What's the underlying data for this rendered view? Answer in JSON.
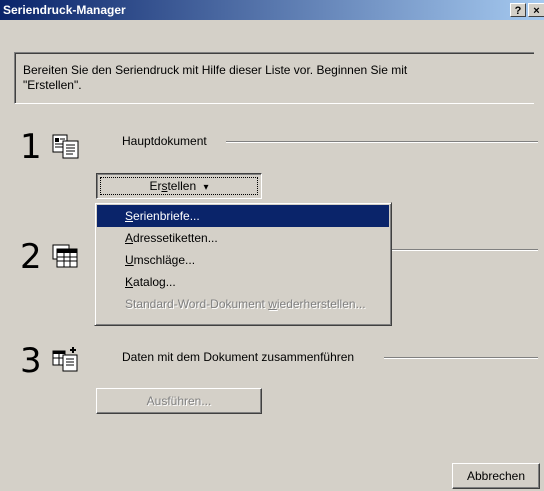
{
  "window": {
    "title": "Seriendruck-Manager",
    "help_label": "?",
    "close_label": "×"
  },
  "instructions": {
    "line1": "Bereiten Sie den Seriendruck mit Hilfe dieser Liste vor. Beginnen Sie mit",
    "line2": "\"Erstellen\"."
  },
  "steps": [
    {
      "number": "1",
      "label": "Hauptdokument",
      "icon": "main-document-icon"
    },
    {
      "number": "2",
      "label": "",
      "icon": "data-source-icon"
    },
    {
      "number": "3",
      "label": "Daten mit dem Dokument zusammenführen",
      "icon": "merge-icon"
    }
  ],
  "buttons": {
    "create_pre": "Er",
    "create_acc": "s",
    "create_post": "tellen",
    "create_arrow": "▾",
    "execute": "Ausführen...",
    "cancel": "Abbrechen"
  },
  "menu": {
    "items": [
      {
        "acc": "S",
        "rest": "erienbriefe...",
        "state": "selected"
      },
      {
        "acc": "A",
        "rest": "dressetiketten...",
        "state": "normal"
      },
      {
        "acc": "U",
        "rest": "mschläge...",
        "state": "normal"
      },
      {
        "acc": "K",
        "rest": "atalog...",
        "state": "normal"
      },
      {
        "pre": "Standard-Word-Dokument ",
        "acc": "w",
        "rest": "iederherstellen...",
        "state": "disabled"
      }
    ]
  },
  "colors": {
    "face": "#d4d0c8",
    "titlebar_start": "#0a246a",
    "titlebar_end": "#a6caf0",
    "highlight": "#0a246a",
    "disabled_text": "#808080"
  }
}
